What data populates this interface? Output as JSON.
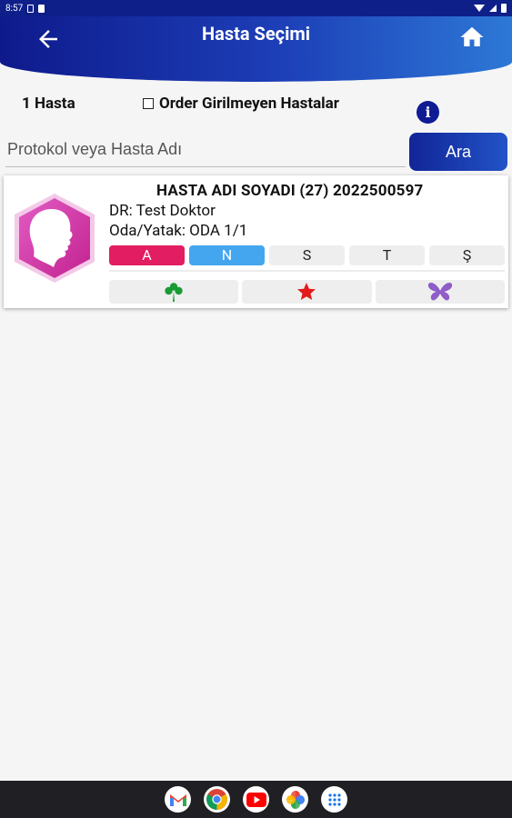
{
  "status_bar": {
    "time": "8:57"
  },
  "header": {
    "title": "Hasta Seçimi"
  },
  "filters": {
    "count_label": "1 Hasta",
    "checkbox_label": "Order Girilmeyen Hastalar"
  },
  "search": {
    "placeholder": "Protokol veya Hasta Adı",
    "button_label": "Ara"
  },
  "patient": {
    "name_line": "HASTA ADI SOYADI (27) 2022500597",
    "doctor_line": "DR: Test Doktor",
    "room_line": "Oda/Yatak: ODA 1/1",
    "days": [
      {
        "label": "A",
        "state": "active-red"
      },
      {
        "label": "N",
        "state": "active-blue"
      },
      {
        "label": "S",
        "state": "inactive"
      },
      {
        "label": "T",
        "state": "inactive"
      },
      {
        "label": "Ş",
        "state": "inactive"
      }
    ],
    "markers": [
      {
        "icon": "clover-icon",
        "color": "#1a9a35"
      },
      {
        "icon": "star-icon",
        "color": "#e31b1b"
      },
      {
        "icon": "butterfly-icon",
        "color": "#8f5cc8"
      }
    ]
  },
  "colors": {
    "header_start": "#0e1a8c",
    "header_end": "#2d78d6",
    "badge_red": "#e21d61",
    "badge_blue": "#44a6ee",
    "avatar_pink": "#d63aaa"
  },
  "navbar": {
    "apps": [
      "gmail-icon",
      "chrome-icon",
      "youtube-icon",
      "photos-icon",
      "apps-grid-icon"
    ]
  }
}
